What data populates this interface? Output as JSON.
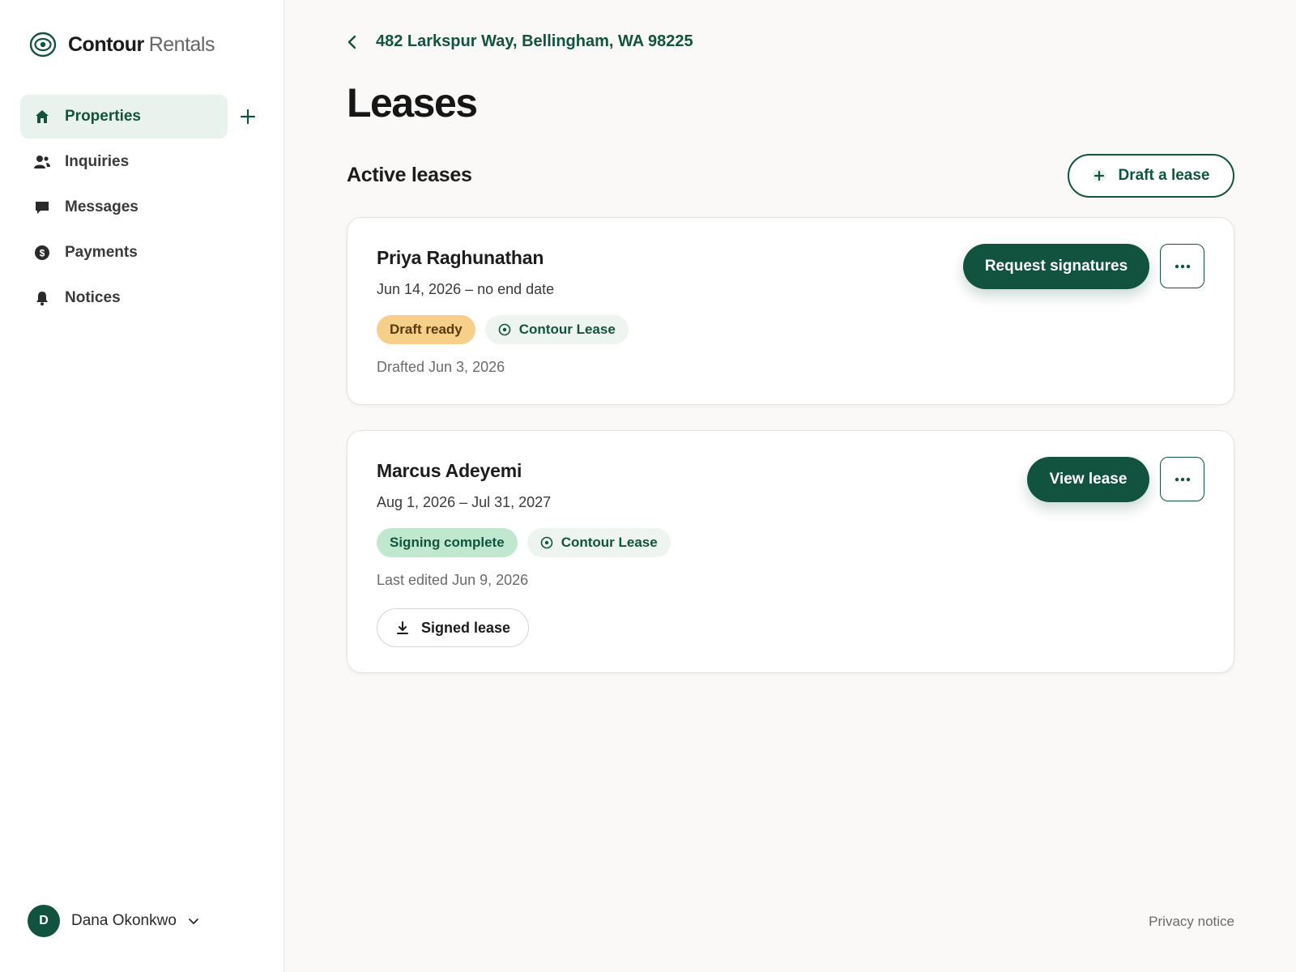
{
  "brand": {
    "name_bold": "Contour",
    "name_light": "Rentals",
    "logo_icon": "eye-ring-icon"
  },
  "sidebar": {
    "items": [
      {
        "label": "Properties",
        "icon": "home-icon",
        "active": true
      },
      {
        "label": "Inquiries",
        "icon": "people-icon"
      },
      {
        "label": "Messages",
        "icon": "chat-bubble-icon"
      },
      {
        "label": "Payments",
        "icon": "dollar-circle-icon"
      },
      {
        "label": "Notices",
        "icon": "bell-icon"
      }
    ],
    "add_icon": "plus-icon"
  },
  "user": {
    "initial": "D",
    "name": "Dana Okonkwo",
    "menu_icon": "chevron-down-icon"
  },
  "breadcrumb": {
    "label": "482 Larkspur Way, Bellingham, WA 98225",
    "icon": "chevron-left-icon"
  },
  "page": {
    "title": "Leases"
  },
  "section": {
    "title": "Active leases",
    "draft_button": "Draft a lease",
    "draft_icon": "plus-circle-icon"
  },
  "leases": [
    {
      "tenant": "Priya Raghunathan",
      "dates": "Jun 14, 2026 – no end date",
      "status": "Draft ready",
      "template": "Contour Lease",
      "meta": "Drafted Jun 3, 2026",
      "action": "Request signatures",
      "more_icon": "ellipsis-icon"
    },
    {
      "tenant": "Marcus Adeyemi",
      "dates": "Aug 1, 2026 – Jul 31, 2027",
      "status": "Signing complete",
      "template": "Contour Lease",
      "meta": "Last edited Jun 9, 2026",
      "action": "View lease",
      "more_icon": "ellipsis-icon",
      "download_label": "Signed lease",
      "download_icon": "download-icon"
    }
  ],
  "footer": {
    "privacy": "Privacy notice"
  },
  "colors": {
    "brand": "#12533f",
    "active_nav_bg": "#e9f2ec",
    "draft_badge": "#f6cf8a",
    "complete_badge": "#bfe8cf",
    "page_bg": "#faf9f7"
  }
}
